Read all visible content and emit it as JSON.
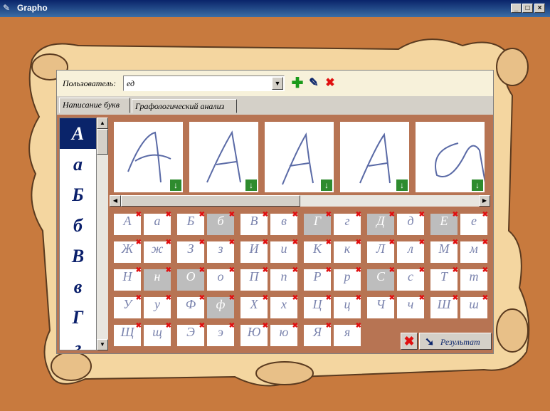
{
  "window": {
    "title": "Grapho",
    "minimize": "_",
    "maximize": "□",
    "close": "×"
  },
  "user": {
    "label": "Пользователь:",
    "value": "ед"
  },
  "toolbar": {
    "add": "✚",
    "edit": "✎",
    "delete": "✖"
  },
  "tabs": [
    {
      "label": "Написание букв"
    },
    {
      "label": "Графологический анализ"
    }
  ],
  "letters": [
    "А",
    "а",
    "Б",
    "б",
    "В",
    "в",
    "Г",
    "г"
  ],
  "grid_rows": [
    [
      {
        "g": "А",
        "gray": false
      },
      {
        "g": "а",
        "gray": false
      },
      {
        "g": "Б",
        "gray": false
      },
      {
        "g": "б",
        "gray": true
      },
      {
        "g": "В",
        "gray": false
      },
      {
        "g": "в",
        "gray": false
      },
      {
        "g": "Г",
        "gray": true
      },
      {
        "g": "г",
        "gray": false
      },
      {
        "g": "Д",
        "gray": true
      },
      {
        "g": "д",
        "gray": false
      },
      {
        "g": "Е",
        "gray": true
      },
      {
        "g": "е",
        "gray": false
      }
    ],
    [
      {
        "g": "Ж",
        "gray": false
      },
      {
        "g": "ж",
        "gray": false
      },
      {
        "g": "З",
        "gray": false
      },
      {
        "g": "з",
        "gray": false
      },
      {
        "g": "И",
        "gray": false
      },
      {
        "g": "и",
        "gray": false
      },
      {
        "g": "К",
        "gray": false
      },
      {
        "g": "к",
        "gray": false
      },
      {
        "g": "Л",
        "gray": false
      },
      {
        "g": "л",
        "gray": false
      },
      {
        "g": "М",
        "gray": false
      },
      {
        "g": "м",
        "gray": false
      }
    ],
    [
      {
        "g": "Н",
        "gray": false
      },
      {
        "g": "н",
        "gray": true
      },
      {
        "g": "О",
        "gray": true
      },
      {
        "g": "о",
        "gray": false
      },
      {
        "g": "П",
        "gray": false
      },
      {
        "g": "п",
        "gray": false
      },
      {
        "g": "Р",
        "gray": false
      },
      {
        "g": "р",
        "gray": false
      },
      {
        "g": "С",
        "gray": true
      },
      {
        "g": "с",
        "gray": false
      },
      {
        "g": "Т",
        "gray": false
      },
      {
        "g": "т",
        "gray": false
      }
    ],
    [
      {
        "g": "У",
        "gray": false
      },
      {
        "g": "у",
        "gray": false
      },
      {
        "g": "Ф",
        "gray": false
      },
      {
        "g": "ф",
        "gray": true
      },
      {
        "g": "Х",
        "gray": false
      },
      {
        "g": "х",
        "gray": false
      },
      {
        "g": "Ц",
        "gray": false
      },
      {
        "g": "ц",
        "gray": false
      },
      {
        "g": "Ч",
        "gray": false
      },
      {
        "g": "ч",
        "gray": false
      },
      {
        "g": "Ш",
        "gray": false
      },
      {
        "g": "ш",
        "gray": false
      }
    ],
    [
      {
        "g": "Щ",
        "gray": false
      },
      {
        "g": "щ",
        "gray": false
      },
      {
        "g": "Э",
        "gray": false
      },
      {
        "g": "э",
        "gray": false
      },
      {
        "g": "Ю",
        "gray": false
      },
      {
        "g": "ю",
        "gray": false
      },
      {
        "g": "Я",
        "gray": false
      },
      {
        "g": "я",
        "gray": false
      }
    ]
  ],
  "delete_marker": "✖",
  "download_marker": "↓",
  "result_button": {
    "label": "Результат",
    "icon": "arrow-icon"
  },
  "colors": {
    "background": "#c87a3e",
    "parchment": "#f7d9a3",
    "letter": "#0a1f6b",
    "delete": "#e01010"
  }
}
